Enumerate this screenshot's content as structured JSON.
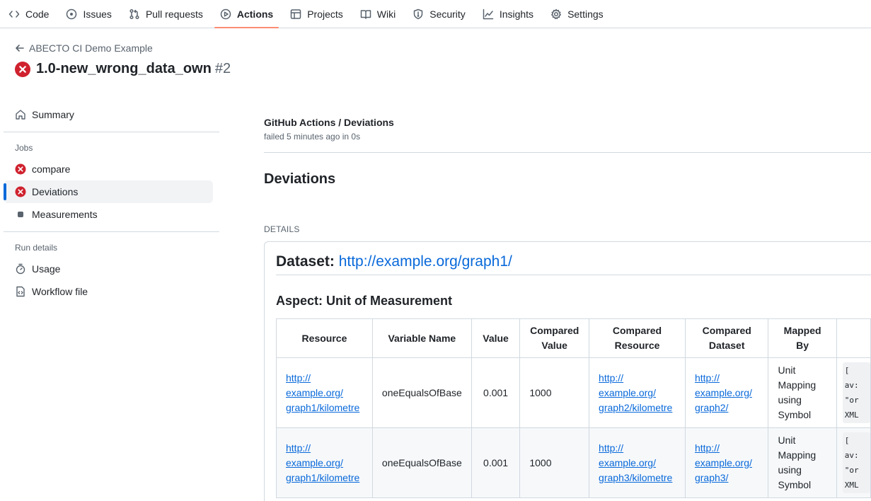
{
  "nav": {
    "tabs": [
      {
        "label": "Code",
        "icon": "code-icon"
      },
      {
        "label": "Issues",
        "icon": "issue-opened-icon"
      },
      {
        "label": "Pull requests",
        "icon": "git-pull-request-icon"
      },
      {
        "label": "Actions",
        "icon": "play-icon",
        "active": true
      },
      {
        "label": "Projects",
        "icon": "table-icon"
      },
      {
        "label": "Wiki",
        "icon": "book-icon"
      },
      {
        "label": "Security",
        "icon": "shield-icon"
      },
      {
        "label": "Insights",
        "icon": "graph-icon"
      },
      {
        "label": "Settings",
        "icon": "gear-icon"
      }
    ]
  },
  "header": {
    "back_label": "ABECTO CI Demo Example",
    "run_name": "1.0-new_wrong_data_own",
    "run_number": "#2"
  },
  "sidebar": {
    "summary_label": "Summary",
    "jobs_heading": "Jobs",
    "jobs": [
      {
        "label": "compare",
        "status": "failed"
      },
      {
        "label": "Deviations",
        "status": "failed",
        "selected": true
      },
      {
        "label": "Measurements",
        "status": "pending"
      }
    ],
    "run_details_heading": "Run details",
    "usage_label": "Usage",
    "workflow_label": "Workflow file"
  },
  "check": {
    "title": "GitHub Actions / Deviations",
    "subtitle": "failed 5 minutes ago in 0s",
    "heading": "Deviations",
    "details_label": "DETAILS",
    "dataset_prefix": "Dataset: ",
    "dataset_link": "http://example.org/graph1/",
    "aspect_heading": "Aspect: Unit of Measurement"
  },
  "table": {
    "headers": {
      "resource": "Resource",
      "variable": "Variable Name",
      "value": "Value",
      "compared_value": "Compared Value",
      "compared_resource": "Compared Resource",
      "compared_dataset": "Compared Dataset",
      "mapped_by": "Mapped By"
    },
    "rows": [
      {
        "resource_a": "http://",
        "resource_b": "example.org/",
        "resource_c": "graph1/kilometre",
        "variable": "oneEqualsOfBase",
        "value": "0.001",
        "compared_value": "1000",
        "cres_a": "http://",
        "cres_b": "example.org/",
        "cres_c": "graph2/kilometre",
        "cds_a": "http://",
        "cds_b": "example.org/",
        "cds_c": "graph2/",
        "map_a": "Unit",
        "map_b": "Mapping",
        "map_c": "using Symbol",
        "code_a": "[",
        "code_b": "av:",
        "code_c": "\"or",
        "code_d": "XML"
      },
      {
        "resource_a": "http://",
        "resource_b": "example.org/",
        "resource_c": "graph1/kilometre",
        "variable": "oneEqualsOfBase",
        "value": "0.001",
        "compared_value": "1000",
        "cres_a": "http://",
        "cres_b": "example.org/",
        "cres_c": "graph3/kilometre",
        "cds_a": "http://",
        "cds_b": "example.org/",
        "cds_c": "graph3/",
        "map_a": "Unit",
        "map_b": "Mapping",
        "map_c": "using Symbol",
        "code_a": "[",
        "code_b": "av:",
        "code_c": "\"or",
        "code_d": "XML"
      }
    ]
  },
  "colors": {
    "accent": "#0969da",
    "fail": "#cf222e",
    "active_tab": "#fd8c73"
  }
}
